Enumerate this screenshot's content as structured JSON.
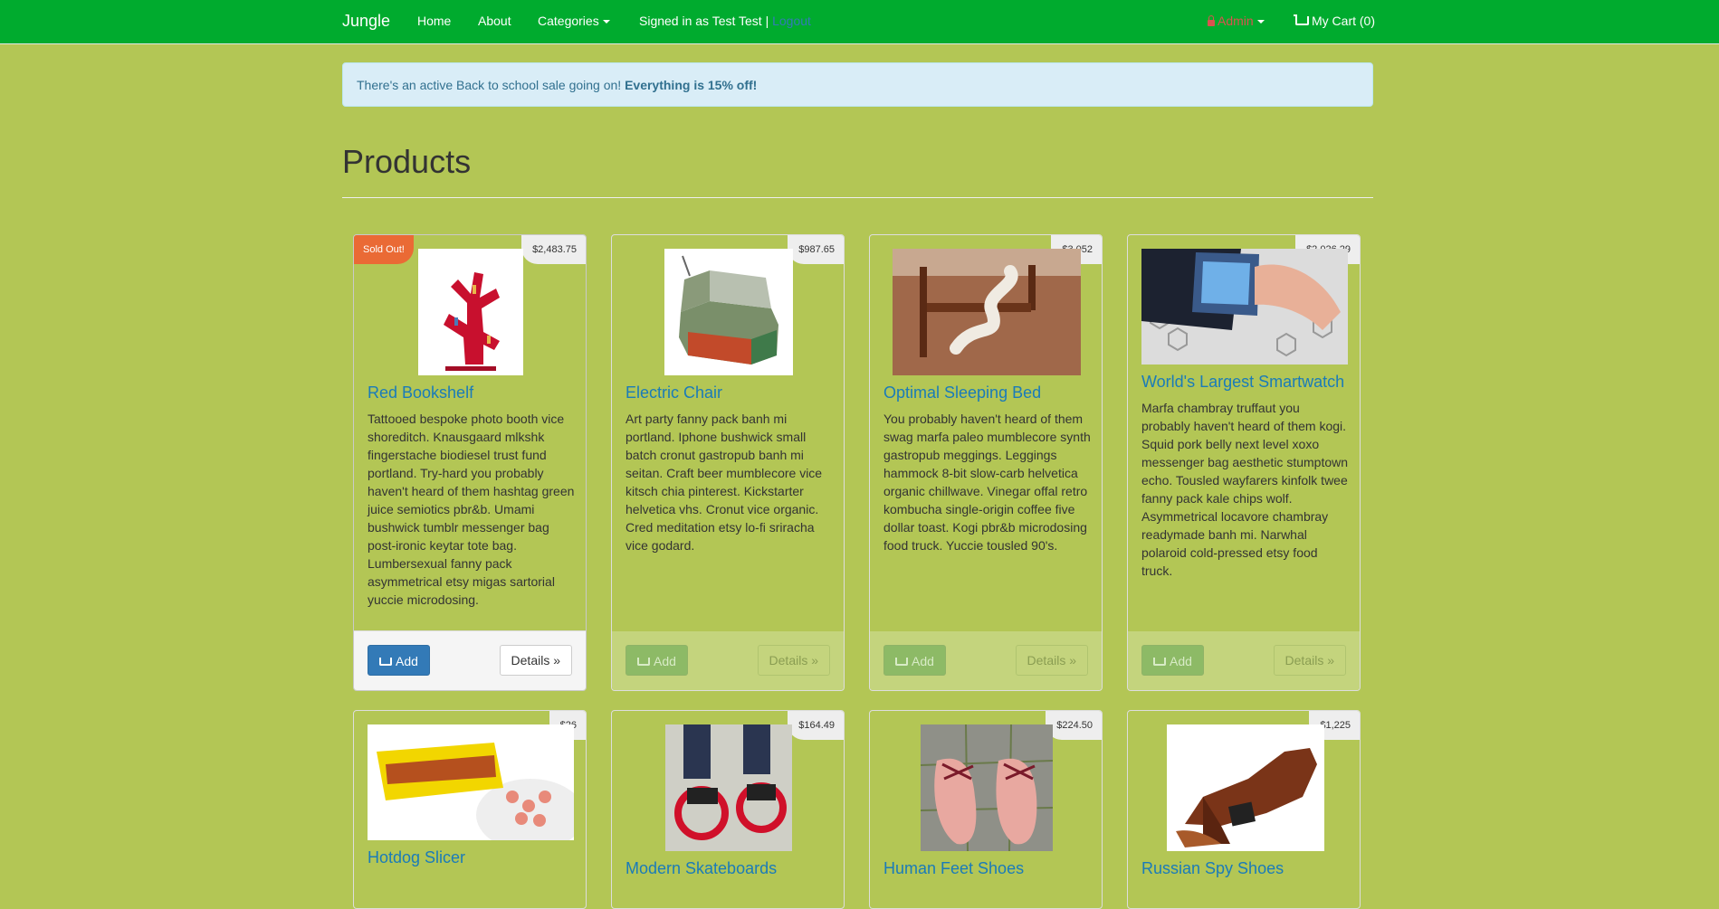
{
  "nav": {
    "brand": "Jungle",
    "home": "Home",
    "about": "About",
    "categories": "Categories",
    "signed_in": "Signed in as Test Test |",
    "logout": "Logout",
    "admin": "Admin",
    "cart": "My Cart (0)"
  },
  "alert": {
    "text": "There's an active Back to school sale going on!",
    "strong": "Everything is 15% off!"
  },
  "page": {
    "title": "Products"
  },
  "buttons": {
    "add": "Add",
    "details": "Details »"
  },
  "products": [
    {
      "name": "Red Bookshelf",
      "price": "$2,483.75",
      "badge": "Sold Out!",
      "description": "Tattooed bespoke photo booth vice shoreditch. Knausgaard mlkshk fingerstache biodiesel trust fund portland. Try-hard you probably haven't heard of them hashtag green juice semiotics pbr&b. Umami bushwick tumblr messenger bag post-ironic keytar tote bag. Lumbersexual fanny pack asymmetrical etsy migas sartorial yuccie microdosing."
    },
    {
      "name": "Electric Chair",
      "price": "$987.65",
      "description": "Art party fanny pack banh mi portland. Iphone bushwick small batch cronut gastropub banh mi seitan. Craft beer mumblecore vice kitsch chia pinterest. Kickstarter helvetica vhs. Cronut vice organic. Cred meditation etsy lo-fi sriracha vice godard."
    },
    {
      "name": "Optimal Sleeping Bed",
      "price": "$3,052",
      "description": "You probably haven't heard of them swag marfa paleo mumblecore synth gastropub meggings. Leggings hammock 8-bit slow-carb helvetica organic chillwave. Vinegar offal retro kombucha single-origin coffee five dollar toast. Kogi pbr&b microdosing food truck. Yuccie tousled 90's."
    },
    {
      "name": "World's Largest Smartwatch",
      "price": "$2,026.29",
      "description": "Marfa chambray truffaut you probably haven't heard of them kogi. Squid pork belly next level xoxo messenger bag aesthetic stumptown echo. Tousled wayfarers kinfolk twee fanny pack kale chips wolf. Asymmetrical locavore chambray readymade banh mi. Narwhal polaroid cold-pressed etsy food truck."
    },
    {
      "name": "Hotdog Slicer",
      "price": "$26"
    },
    {
      "name": "Modern Skateboards",
      "price": "$164.49"
    },
    {
      "name": "Human Feet Shoes",
      "price": "$224.50"
    },
    {
      "name": "Russian Spy Shoes",
      "price": "$1,225"
    }
  ]
}
